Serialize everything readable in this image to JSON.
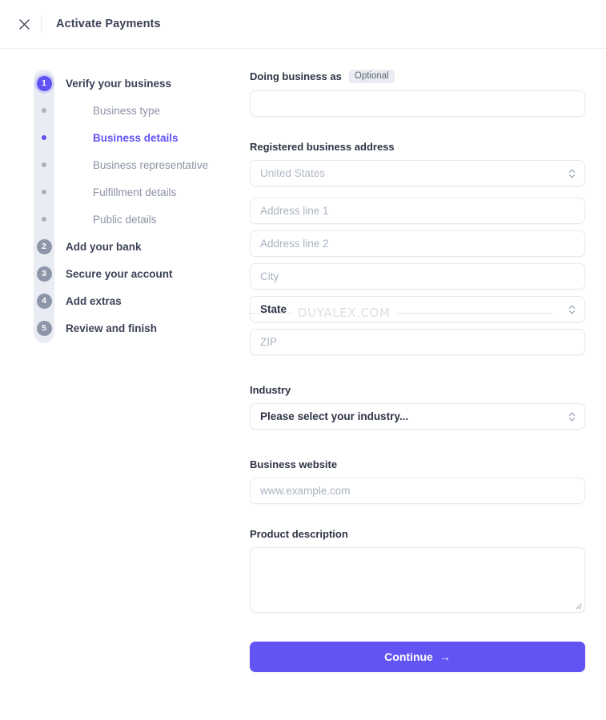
{
  "header": {
    "close_icon": "close-icon",
    "title": "Activate Payments"
  },
  "stepper": {
    "steps": [
      {
        "number": "1",
        "label": "Verify your business",
        "state": "active",
        "substeps": [
          {
            "label": "Business type",
            "state": "inactive"
          },
          {
            "label": "Business details",
            "state": "active"
          },
          {
            "label": "Business representative",
            "state": "inactive"
          },
          {
            "label": "Fulfillment details",
            "state": "inactive"
          },
          {
            "label": "Public details",
            "state": "inactive"
          }
        ]
      },
      {
        "number": "2",
        "label": "Add your bank",
        "state": "inactive",
        "substeps": []
      },
      {
        "number": "3",
        "label": "Secure your account",
        "state": "inactive",
        "substeps": []
      },
      {
        "number": "4",
        "label": "Add extras",
        "state": "inactive",
        "substeps": []
      },
      {
        "number": "5",
        "label": "Review and finish",
        "state": "inactive",
        "substeps": []
      }
    ]
  },
  "form": {
    "doing_business_as": {
      "label": "Doing business as",
      "badge": "Optional",
      "value": "",
      "placeholder": ""
    },
    "registered_address": {
      "label": "Registered business address",
      "country": {
        "value": "United States",
        "placeholder": "United States"
      },
      "address_line_1": {
        "value": "",
        "placeholder": "Address line 1"
      },
      "address_line_2": {
        "value": "",
        "placeholder": "Address line 2"
      },
      "city": {
        "value": "",
        "placeholder": "City"
      },
      "state": {
        "value": "State",
        "placeholder": "State"
      },
      "zip": {
        "value": "",
        "placeholder": "ZIP"
      }
    },
    "industry": {
      "label": "Industry",
      "value": "Please select your industry...",
      "placeholder": "Please select your industry..."
    },
    "business_website": {
      "label": "Business website",
      "value": "",
      "placeholder": "www.example.com"
    },
    "product_description": {
      "label": "Product description",
      "value": "",
      "placeholder": ""
    },
    "continue_button": {
      "label": "Continue",
      "arrow": "→"
    }
  },
  "watermark": {
    "text": "DUYALEX.COM"
  },
  "colors": {
    "accent": "#6152f3",
    "button": "#6254f3",
    "text": "#3c4257",
    "muted": "#8b93a3",
    "placeholder": "#aab2c0",
    "border": "#e6e9ef",
    "track": "#e9edf3"
  }
}
